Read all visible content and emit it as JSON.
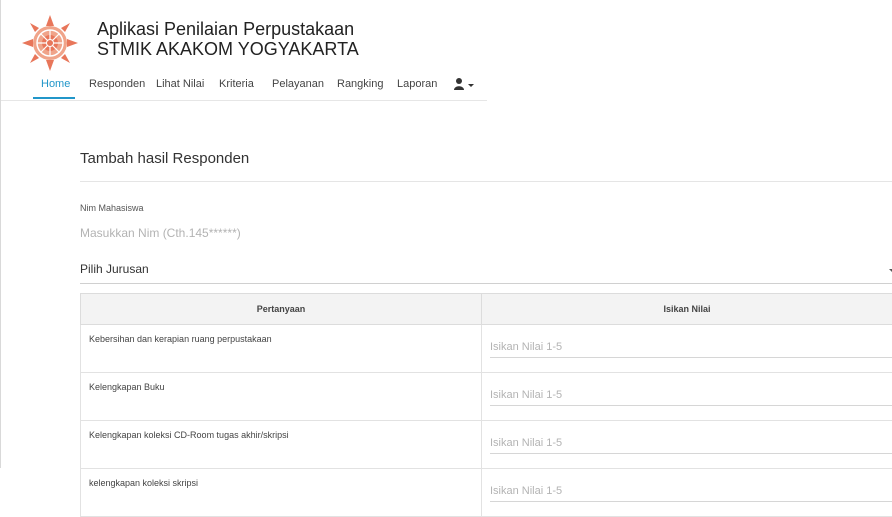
{
  "header": {
    "title": "Aplikasi Penilaian Perpustakaan",
    "subtitle": "STMIK AKAKOM YOGYAKARTA"
  },
  "nav": {
    "items": [
      "Home",
      "Responden",
      "Lihat Nilai",
      "Kriteria",
      "Pelayanan",
      "Rangking",
      "Laporan"
    ],
    "active": "Home",
    "user_icon": "user-icon"
  },
  "form": {
    "title": "Tambah hasil Responden",
    "nim_label": "Nim Mahasiswa",
    "nim_placeholder": "Masukkan Nim (Cth.145******)",
    "nim_value": "",
    "jurusan_label": "Pilih Jurusan"
  },
  "table": {
    "headers": [
      "Pertanyaan",
      "Isikan Nilai"
    ],
    "value_placeholder": "Isikan Nilai 1-5",
    "rows": [
      "Kebersihan dan kerapian ruang perpustakaan",
      "Kelengkapan Buku",
      "Kelengkapan koleksi CD-Room tugas akhir/skripsi",
      "kelengkapan koleksi skripsi"
    ]
  },
  "colors": {
    "accent": "#2196c9",
    "logo": "#e8765a"
  }
}
